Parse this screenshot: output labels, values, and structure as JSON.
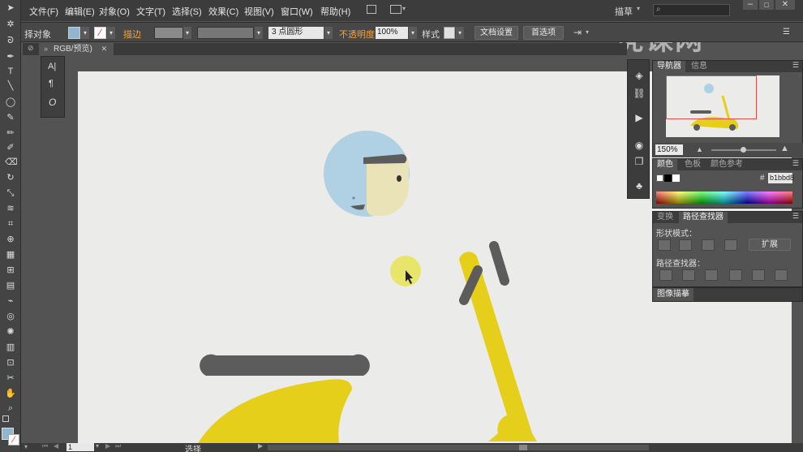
{
  "menubar": {
    "items": [
      "文件(F)",
      "编辑(E)",
      "对象(O)",
      "文字(T)",
      "选择(S)",
      "效果(C)",
      "视图(V)",
      "窗口(W)",
      "帮助(H)"
    ],
    "workspace": "描草",
    "search_placeholder": ""
  },
  "control_bar": {
    "selection_label": "择对象",
    "stroke_label": "描边",
    "brush_size": "3 点圆形",
    "opacity_label": "不透明度",
    "opacity_value": "100%",
    "style_label": "样式",
    "doc_setup_button": "文档设置",
    "preferences_button": "首选项"
  },
  "document_tab": {
    "title": "RGB/预览)"
  },
  "float_panel": {
    "glyphs": [
      "A|",
      "¶",
      "O"
    ]
  },
  "navigator_panel": {
    "tabs": [
      "导航器",
      "信息"
    ],
    "zoom": "150%"
  },
  "color_panel": {
    "tabs": [
      "颜色",
      "色板",
      "颜色参考"
    ],
    "hex_label": "#",
    "hex_value": "b1bbd8"
  },
  "pathfinder_panel": {
    "tabs": [
      "变换",
      "路径查找器"
    ],
    "shape_modes_label": "形状模式：",
    "expand_button": "扩展",
    "pathfinders_label": "路径查找器："
  },
  "image_trace_panel": {
    "title": "图像描摹"
  },
  "statusbar": {
    "page_number": "1",
    "tool_name": "选择"
  },
  "watermark": {
    "text": "虎课网"
  },
  "colors": {
    "helmet": "#b0d1e3",
    "face": "#ebe3b8",
    "scooter_yellow": "#e6cf1a",
    "handle_gray": "#5c5c5c",
    "cursor_highlight": "#e7e66a",
    "nav_frame": "#e24b4b"
  }
}
